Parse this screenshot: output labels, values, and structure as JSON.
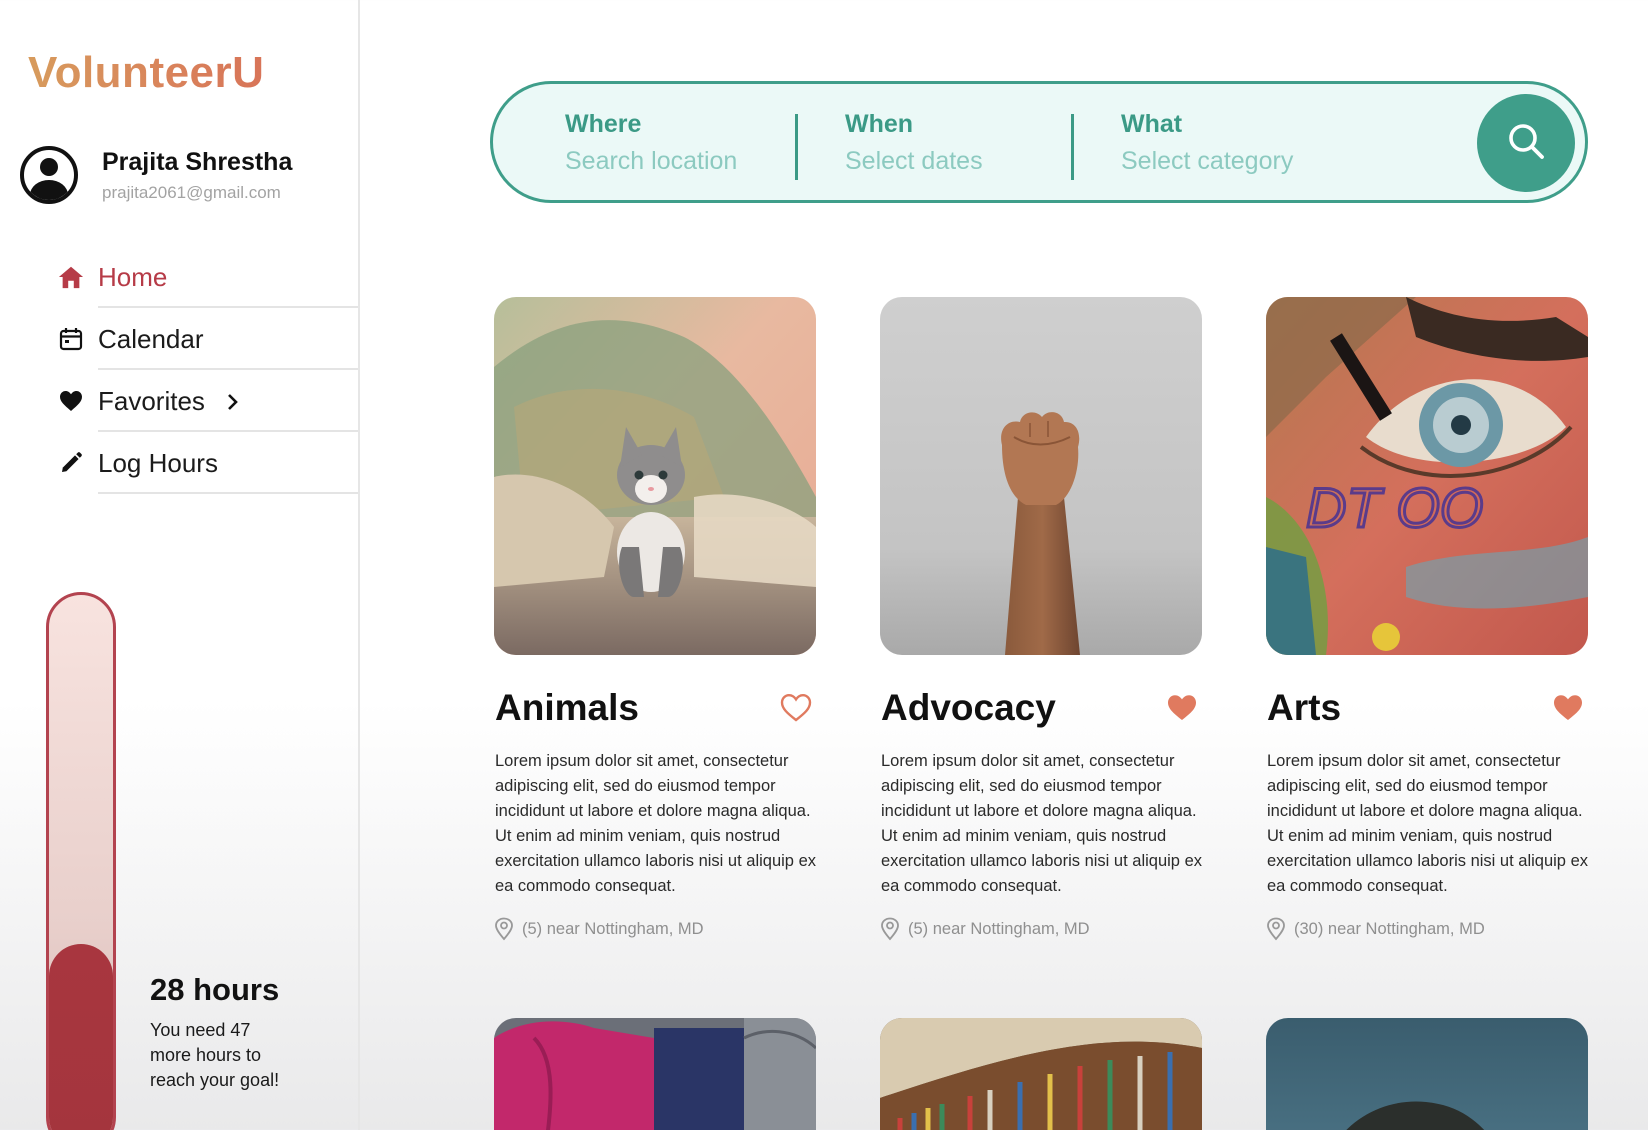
{
  "app": {
    "logo": "VolunteerU"
  },
  "user": {
    "name": "Prajita Shrestha",
    "email": "prajita2061@gmail.com"
  },
  "nav": {
    "items": [
      {
        "label": "Home",
        "icon": "home-icon",
        "active": true
      },
      {
        "label": "Calendar",
        "icon": "calendar-icon",
        "active": false
      },
      {
        "label": "Favorites",
        "icon": "heart-icon",
        "active": false
      },
      {
        "label": "Log Hours",
        "icon": "pencil-icon",
        "active": false
      }
    ]
  },
  "progress": {
    "hours_label": "28 hours",
    "note": "You need 47 more hours to reach your goal!",
    "fraction": 0.37
  },
  "search": {
    "where_label": "Where",
    "where_placeholder": "Search location",
    "when_label": "When",
    "when_placeholder": "Select dates",
    "what_label": "What",
    "what_placeholder": "Select category"
  },
  "cards": [
    {
      "title": "Animals",
      "favorited": false,
      "description": "Lorem ipsum dolor sit amet, consectetur adipiscing elit, sed do eiusmod tempor incididunt ut labore et dolore magna aliqua. Ut enim ad minim veniam, quis nostrud exercitation ullamco laboris nisi ut aliquip ex ea commodo consequat.",
      "location": "(5) near Nottingham, MD"
    },
    {
      "title": "Advocacy",
      "favorited": true,
      "description": "Lorem ipsum dolor sit amet, consectetur adipiscing elit, sed do eiusmod tempor incididunt ut labore et dolore magna aliqua. Ut enim ad minim veniam, quis nostrud exercitation ullamco laboris nisi ut aliquip ex ea commodo consequat.",
      "location": "(5) near Nottingham, MD"
    },
    {
      "title": "Arts",
      "favorited": true,
      "description": "Lorem ipsum dolor sit amet, consectetur adipiscing elit, sed do eiusmod tempor incididunt ut labore et dolore magna aliqua. Ut enim ad minim veniam, quis nostrud exercitation ullamco laboris nisi ut aliquip ex ea commodo consequat.",
      "location": "(30) near Nottingham, MD"
    }
  ],
  "colors": {
    "brand": "#d9835b",
    "accent_teal": "#3f9e8a",
    "active_nav": "#b63b47",
    "heart": "#e07a5f",
    "progress_fill": "#a8363f"
  }
}
